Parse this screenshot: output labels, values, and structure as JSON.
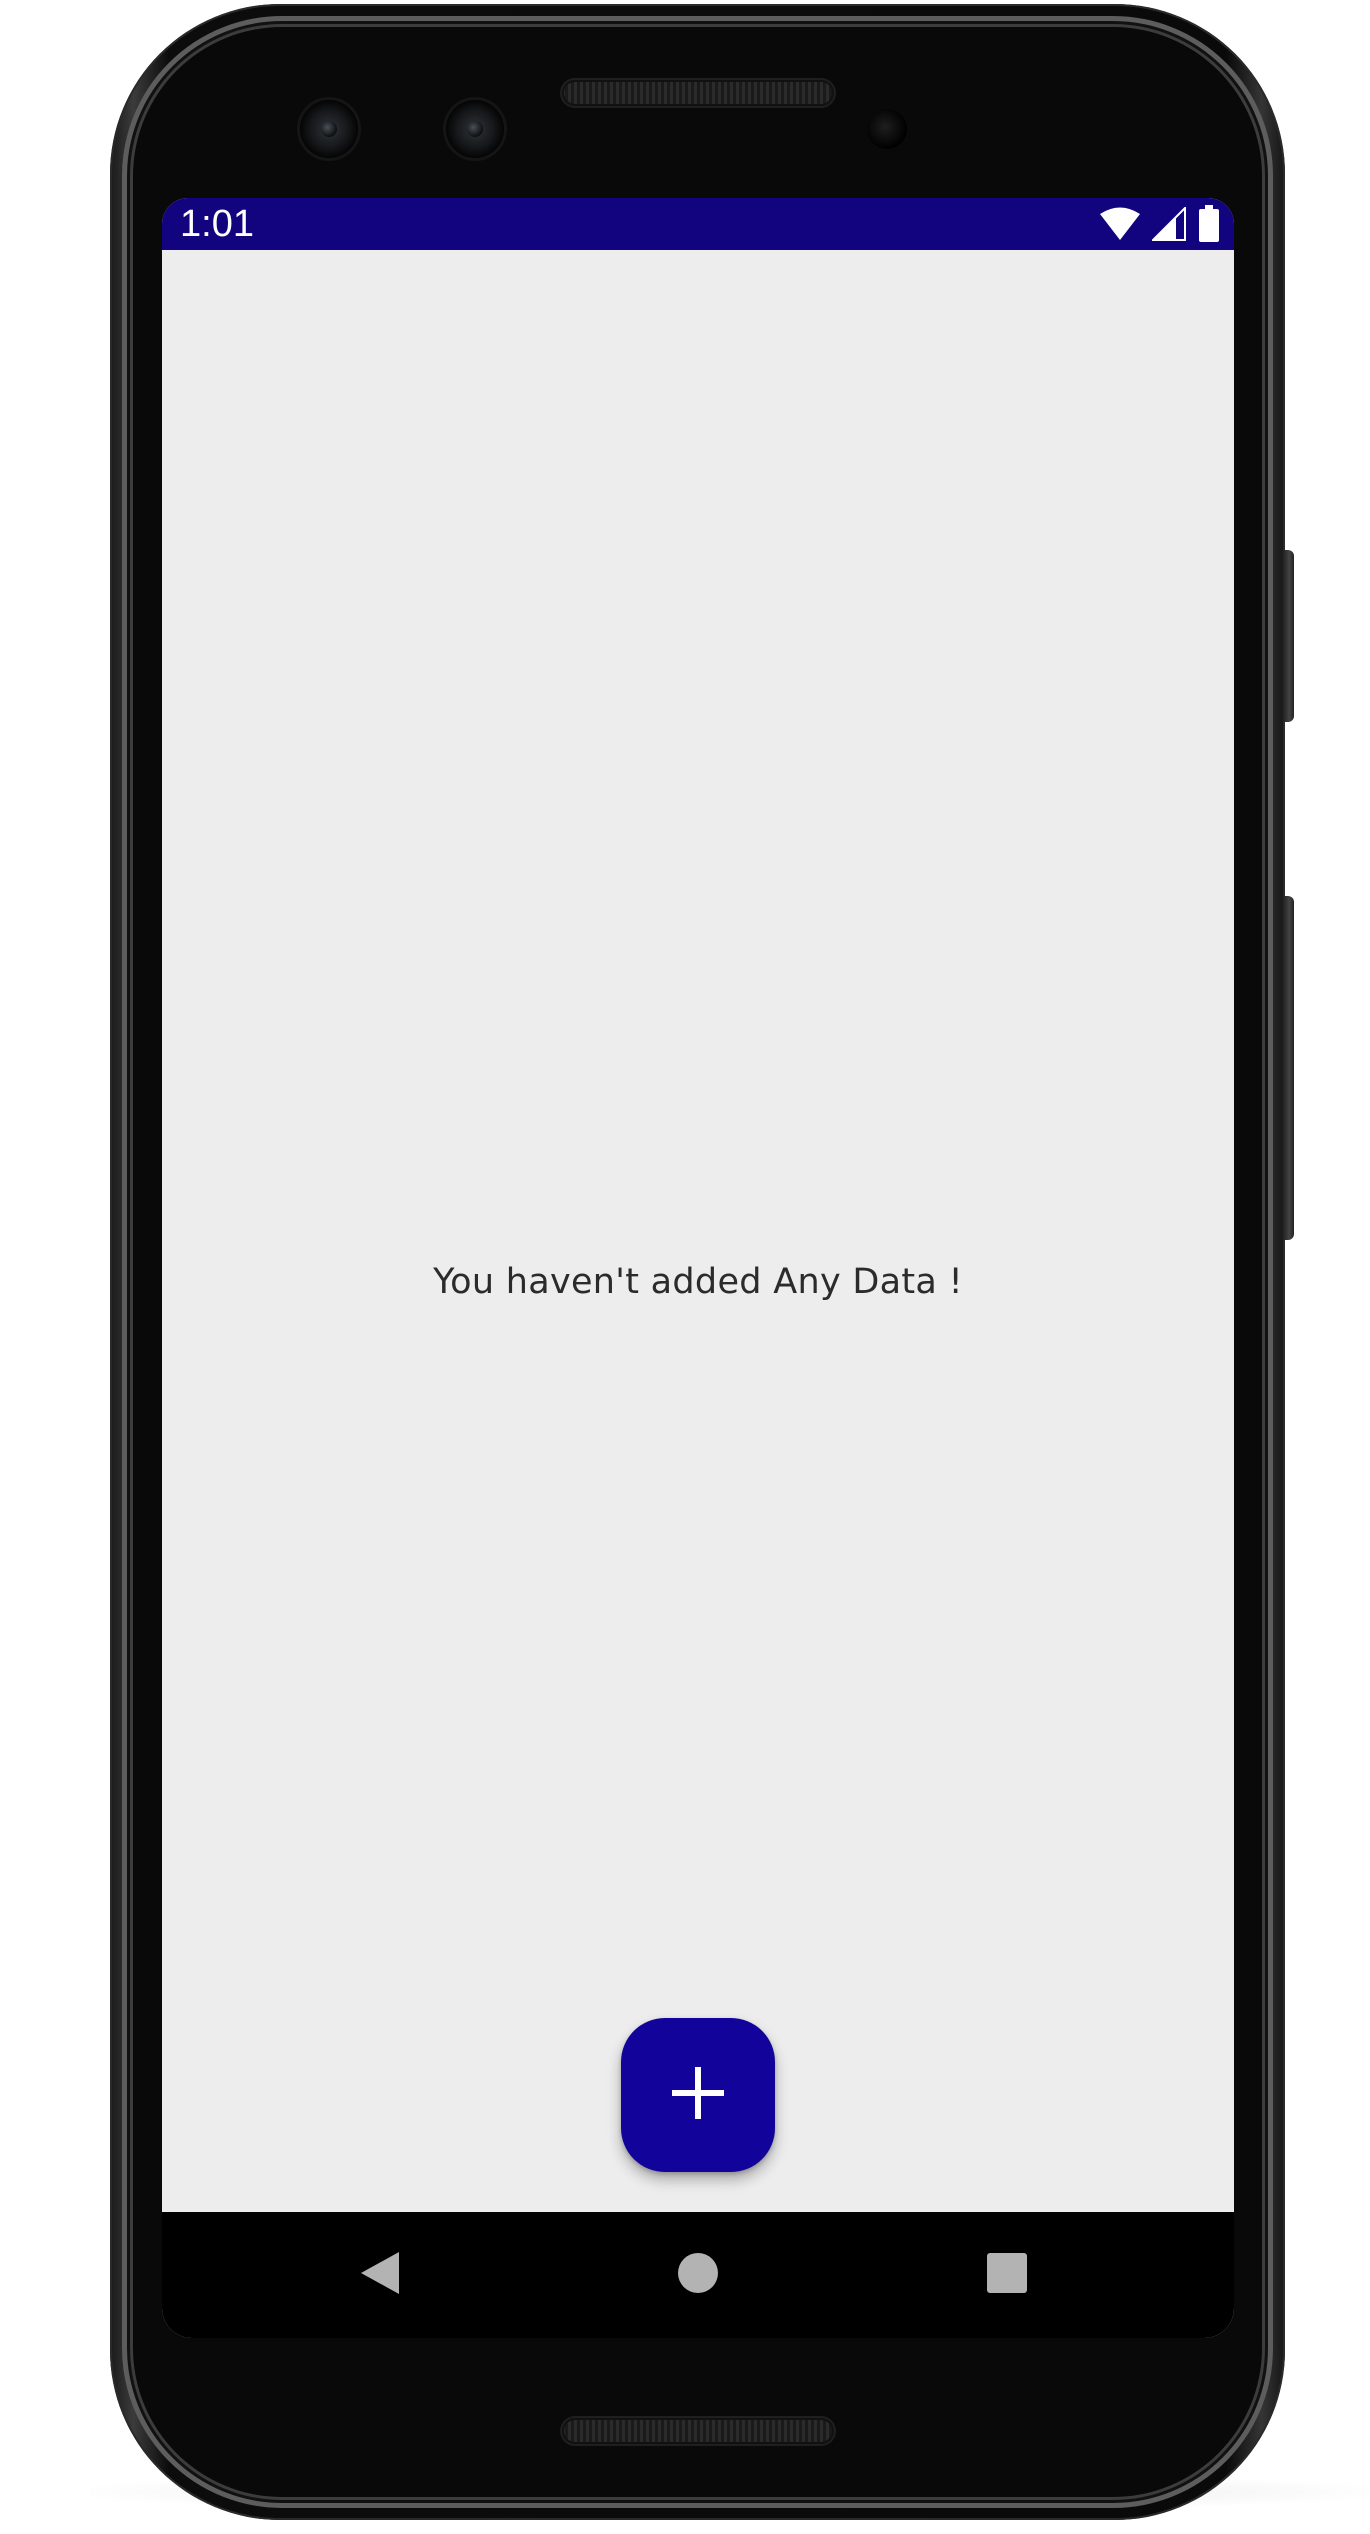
{
  "status_bar": {
    "time": "1:01",
    "background_color": "#12047f",
    "icons": [
      "wifi-icon",
      "cellular-signal-icon",
      "battery-icon"
    ]
  },
  "main": {
    "empty_message": "You haven't added Any Data !",
    "background_color": "#ededed"
  },
  "fab": {
    "icon": "plus-icon",
    "color": "#12049b"
  },
  "navigation_bar": {
    "buttons": [
      "back-icon",
      "home-icon",
      "recents-icon"
    ]
  }
}
